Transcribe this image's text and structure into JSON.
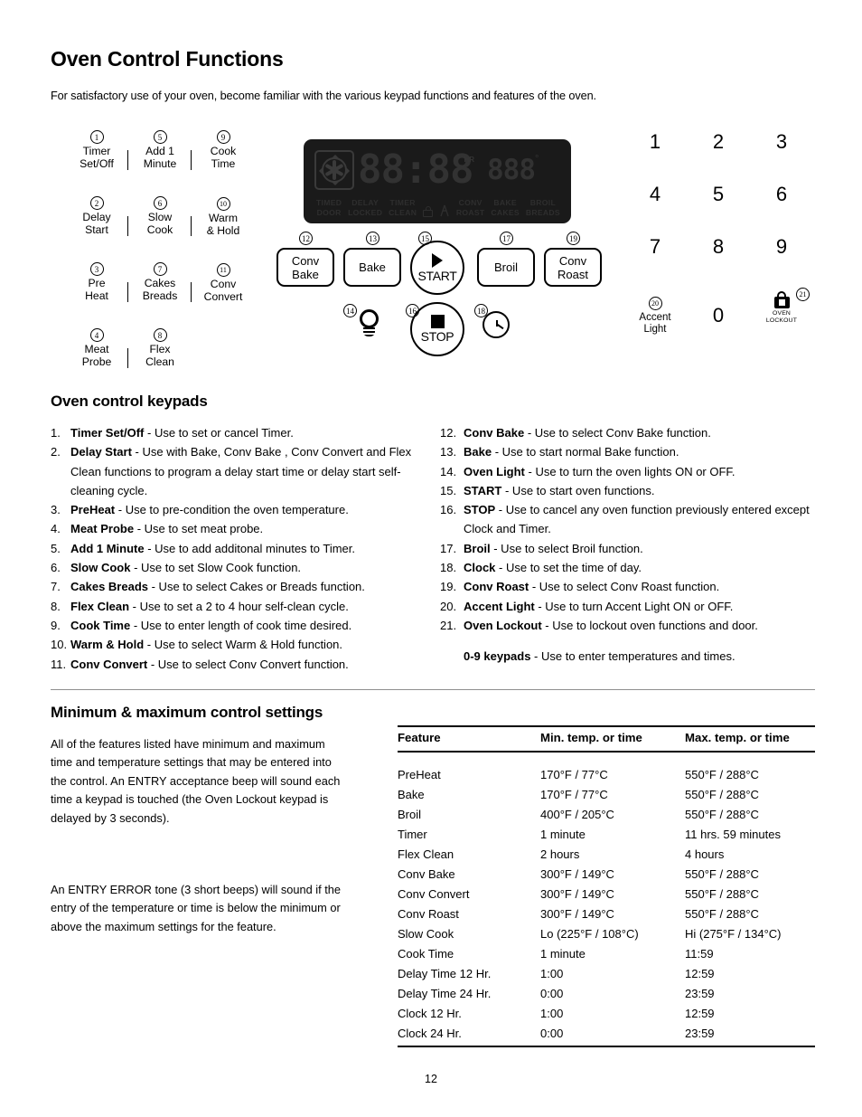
{
  "page": {
    "title": "Oven Control Functions",
    "intro": "For satisfactory use of your oven, become familiar with the various keypad functions and features of the oven.",
    "page_number": "12"
  },
  "control_panel": {
    "legend_keys": [
      {
        "num": "1",
        "label": "Timer\nSet/Off"
      },
      {
        "num": "5",
        "label": "Add 1\nMinute"
      },
      {
        "num": "9",
        "label": "Cook\nTime"
      },
      {
        "num": "2",
        "label": "Delay\nStart"
      },
      {
        "num": "6",
        "label": "Slow\nCook"
      },
      {
        "num": "10",
        "label": "Warm\n& Hold"
      },
      {
        "num": "3",
        "label": "Pre\nHeat"
      },
      {
        "num": "7",
        "label": "Cakes\nBreads"
      },
      {
        "num": "11",
        "label": "Conv\nConvert"
      },
      {
        "num": "4",
        "label": "Meat\nProbe"
      },
      {
        "num": "8",
        "label": "Flex\nClean"
      }
    ],
    "display": {
      "fan_icon": "convection-fan-icon",
      "digits_left": "88:88",
      "digits_right": "888",
      "hr_label": "HR",
      "degree_label": "°",
      "indicators": [
        {
          "top": "TIMED",
          "bottom": "DOOR"
        },
        {
          "top": "DELAY",
          "bottom": "LOCKED"
        },
        {
          "top": "TIMER",
          "bottom": "CLEAN"
        },
        {
          "top": "CONV",
          "bottom": "ROAST"
        },
        {
          "top": "BAKE",
          "bottom": "CAKES"
        },
        {
          "top": "BROIL",
          "bottom": "BREADS"
        }
      ],
      "icon_lock": "door-lock-icon",
      "icon_flame": "flame-icon"
    },
    "function_buttons": [
      {
        "num": "12",
        "label": "Conv\nBake"
      },
      {
        "num": "13",
        "label": "Bake"
      },
      {
        "num": "17",
        "label": "Broil"
      },
      {
        "num": "19",
        "label": "Conv\nRoast"
      }
    ],
    "start_button": {
      "num": "15",
      "label": "START",
      "icon": "play-triangle-icon"
    },
    "stop_button": {
      "num": "16",
      "label": "STOP",
      "icon": "stop-square-icon"
    },
    "light_button": {
      "num": "14",
      "icon": "light-bulb-icon"
    },
    "clock_button": {
      "num": "18",
      "icon": "clock-icon"
    },
    "numpad": {
      "keys": [
        "1",
        "2",
        "3",
        "4",
        "5",
        "6",
        "7",
        "8",
        "9",
        "0"
      ],
      "accent_light": {
        "num": "20",
        "label": "Accent\nLight"
      },
      "oven_lockout": {
        "num": "21",
        "label": "OVEN\nLOCKOUT",
        "icon": "padlock-icon"
      }
    }
  },
  "keypads_section": {
    "heading": "Oven control keypads",
    "left_items": [
      {
        "index": "1.",
        "name": "Timer Set/Off",
        "desc": " - Use to set or cancel Timer."
      },
      {
        "index": "2.",
        "name": "Delay Start",
        "desc": " - Use with Bake, Conv Bake , Conv Convert and Flex Clean functions to program a delay start time or delay start self-cleaning cycle."
      },
      {
        "index": "3.",
        "name": "PreHeat",
        "desc": " - Use to pre-condition the oven temperature."
      },
      {
        "index": "4.",
        "name": "Meat Probe",
        "desc": " - Use to set meat probe."
      },
      {
        "index": "5.",
        "name": "Add 1 Minute",
        "desc": " - Use to add additonal minutes to Timer."
      },
      {
        "index": "6.",
        "name": "Slow Cook",
        "desc": " - Use to set Slow Cook  function."
      },
      {
        "index": "7.",
        "name": "Cakes Breads",
        "desc": " - Use to select Cakes or Breads function."
      },
      {
        "index": "8.",
        "name": "Flex Clean",
        "desc": " - Use to set a 2 to 4 hour self-clean cycle."
      },
      {
        "index": "9.",
        "name": "Cook Time",
        "desc": " - Use to enter length of cook time desired."
      },
      {
        "index": "10.",
        "name": "Warm & Hold",
        "desc": " - Use to select Warm & Hold function."
      },
      {
        "index": "11.",
        "name": "Conv Convert",
        "desc": " - Use to select Conv Convert function."
      }
    ],
    "right_items": [
      {
        "index": "12.",
        "name": "Conv Bake",
        "desc": " - Use to select Conv Bake function."
      },
      {
        "index": "13.",
        "name": "Bake",
        "desc": " - Use to start normal Bake function."
      },
      {
        "index": "14.",
        "name": "Oven Light",
        "desc": " - Use to turn the oven lights ON or OFF."
      },
      {
        "index": "15.",
        "name": "START",
        "desc": " - Use to start oven functions."
      },
      {
        "index": "16.",
        "name": "STOP",
        "desc": " - Use to cancel any oven function previously entered except Clock and Timer."
      },
      {
        "index": "17.",
        "name": "Broil",
        "desc": " - Use to select Broil function."
      },
      {
        "index": "18.",
        "name": "Clock",
        "desc": " - Use to set the time of day."
      },
      {
        "index": "19.",
        "name": "Conv Roast",
        "desc": " - Use to select Conv Roast function."
      },
      {
        "index": "20.",
        "name": "Accent Light",
        "desc": " -  Use to turn Accent Light ON or OFF."
      },
      {
        "index": "21.",
        "name": "Oven Lockout",
        "desc": " - Use to lockout oven functions and door."
      }
    ],
    "note_name": "0-9 keypads",
    "note_desc": " - Use to enter temperatures and times."
  },
  "minmax_section": {
    "heading": "Minimum & maximum control settings",
    "para1": "All of the features listed have minimum and maximum time and temperature settings that may be entered into the control.  An ENTRY acceptance beep will sound each time a keypad is touched (the Oven Lockout keypad is delayed by 3 seconds).",
    "para2": "An ENTRY ERROR tone (3 short beeps) will sound if the entry of the temperature or time is below the minimum or above the maximum settings for the feature.",
    "table": {
      "headers": [
        "Feature",
        "Min. temp. or time",
        "Max. temp. or time"
      ],
      "rows": [
        [
          "PreHeat",
          "170°F / 77°C",
          "550°F / 288°C"
        ],
        [
          "Bake",
          "170°F / 77°C",
          "550°F / 288°C"
        ],
        [
          "Broil",
          "400°F / 205°C",
          "550°F / 288°C"
        ],
        [
          "Timer",
          "1 minute",
          "11 hrs. 59 minutes"
        ],
        [
          "Flex Clean",
          "2 hours",
          "4 hours"
        ],
        [
          "Conv Bake",
          "300°F / 149°C",
          "550°F / 288°C"
        ],
        [
          "Conv Convert",
          "300°F / 149°C",
          "550°F / 288°C"
        ],
        [
          "Conv Roast",
          "300°F / 149°C",
          "550°F / 288°C"
        ],
        [
          "Slow Cook",
          "Lo (225°F / 108°C)",
          "Hi (275°F / 134°C)"
        ],
        [
          "Cook Time",
          "1 minute",
          "11:59"
        ],
        [
          "Delay Time 12 Hr.",
          "1:00",
          "12:59"
        ],
        [
          "Delay Time 24 Hr.",
          "0:00",
          "23:59"
        ],
        [
          "Clock 12 Hr.",
          "1:00",
          "12:59"
        ],
        [
          "Clock 24 Hr.",
          "0:00",
          "23:59"
        ]
      ]
    }
  }
}
